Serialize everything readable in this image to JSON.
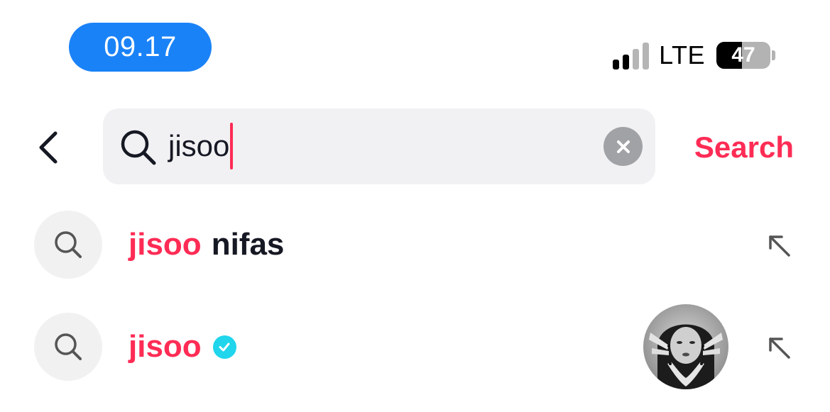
{
  "status_bar": {
    "time": "09.17",
    "network": "LTE",
    "battery": "47",
    "battery_fraction": 0.47,
    "signal_bars_active": 2,
    "signal_bars_total": 4
  },
  "search": {
    "query": "jisoo",
    "submit_label": "Search",
    "accent": "#fe2c55"
  },
  "suggestions": [
    {
      "highlight": "jisoo",
      "rest": "nifas",
      "verified": false,
      "has_avatar": false
    },
    {
      "highlight": "jisoo",
      "rest": "",
      "verified": true,
      "has_avatar": true
    }
  ],
  "colors": {
    "time_pill": "#1a82f7",
    "accent": "#fe2c55",
    "verified_badge": "#20d5ec",
    "field_bg": "#f1f1f3"
  },
  "icons": {
    "back": "chevron-left-icon",
    "search": "magnifier-icon",
    "clear": "clear-x-icon",
    "fill": "arrow-up-left-icon",
    "verified": "checkmark-badge-icon"
  }
}
